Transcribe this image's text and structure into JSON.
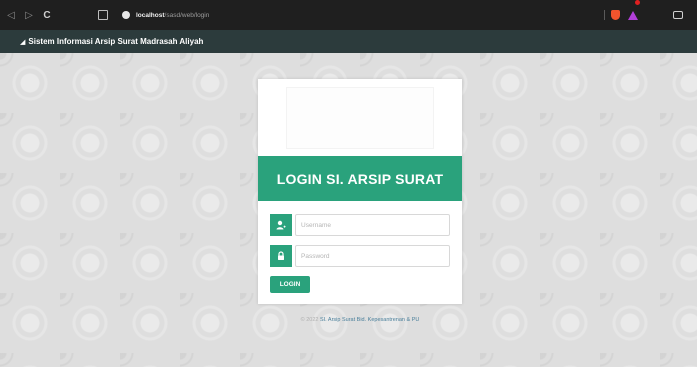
{
  "browser": {
    "back_icon": "◁",
    "forward_icon": "▷",
    "reload_icon": "C",
    "url_host": "localhost",
    "url_path": "/sasd/web/login"
  },
  "header": {
    "icon": "signal-icon",
    "title": "Sistem Informasi Arsip Surat Madrasah Aliyah"
  },
  "login_card": {
    "title": "LOGIN SI. ARSIP SURAT",
    "username_placeholder": "Username",
    "username_value": "",
    "password_placeholder": "Password",
    "password_value": "",
    "login_label": "LOGIN"
  },
  "footer": {
    "year": "© 2022",
    "name": "SI. Arsip Surat Bid. Kepesantrenan & PU"
  },
  "colors": {
    "accent": "#2aa27c",
    "header_bg": "#2c3b3c",
    "browser_bg": "#1f1f1f"
  }
}
